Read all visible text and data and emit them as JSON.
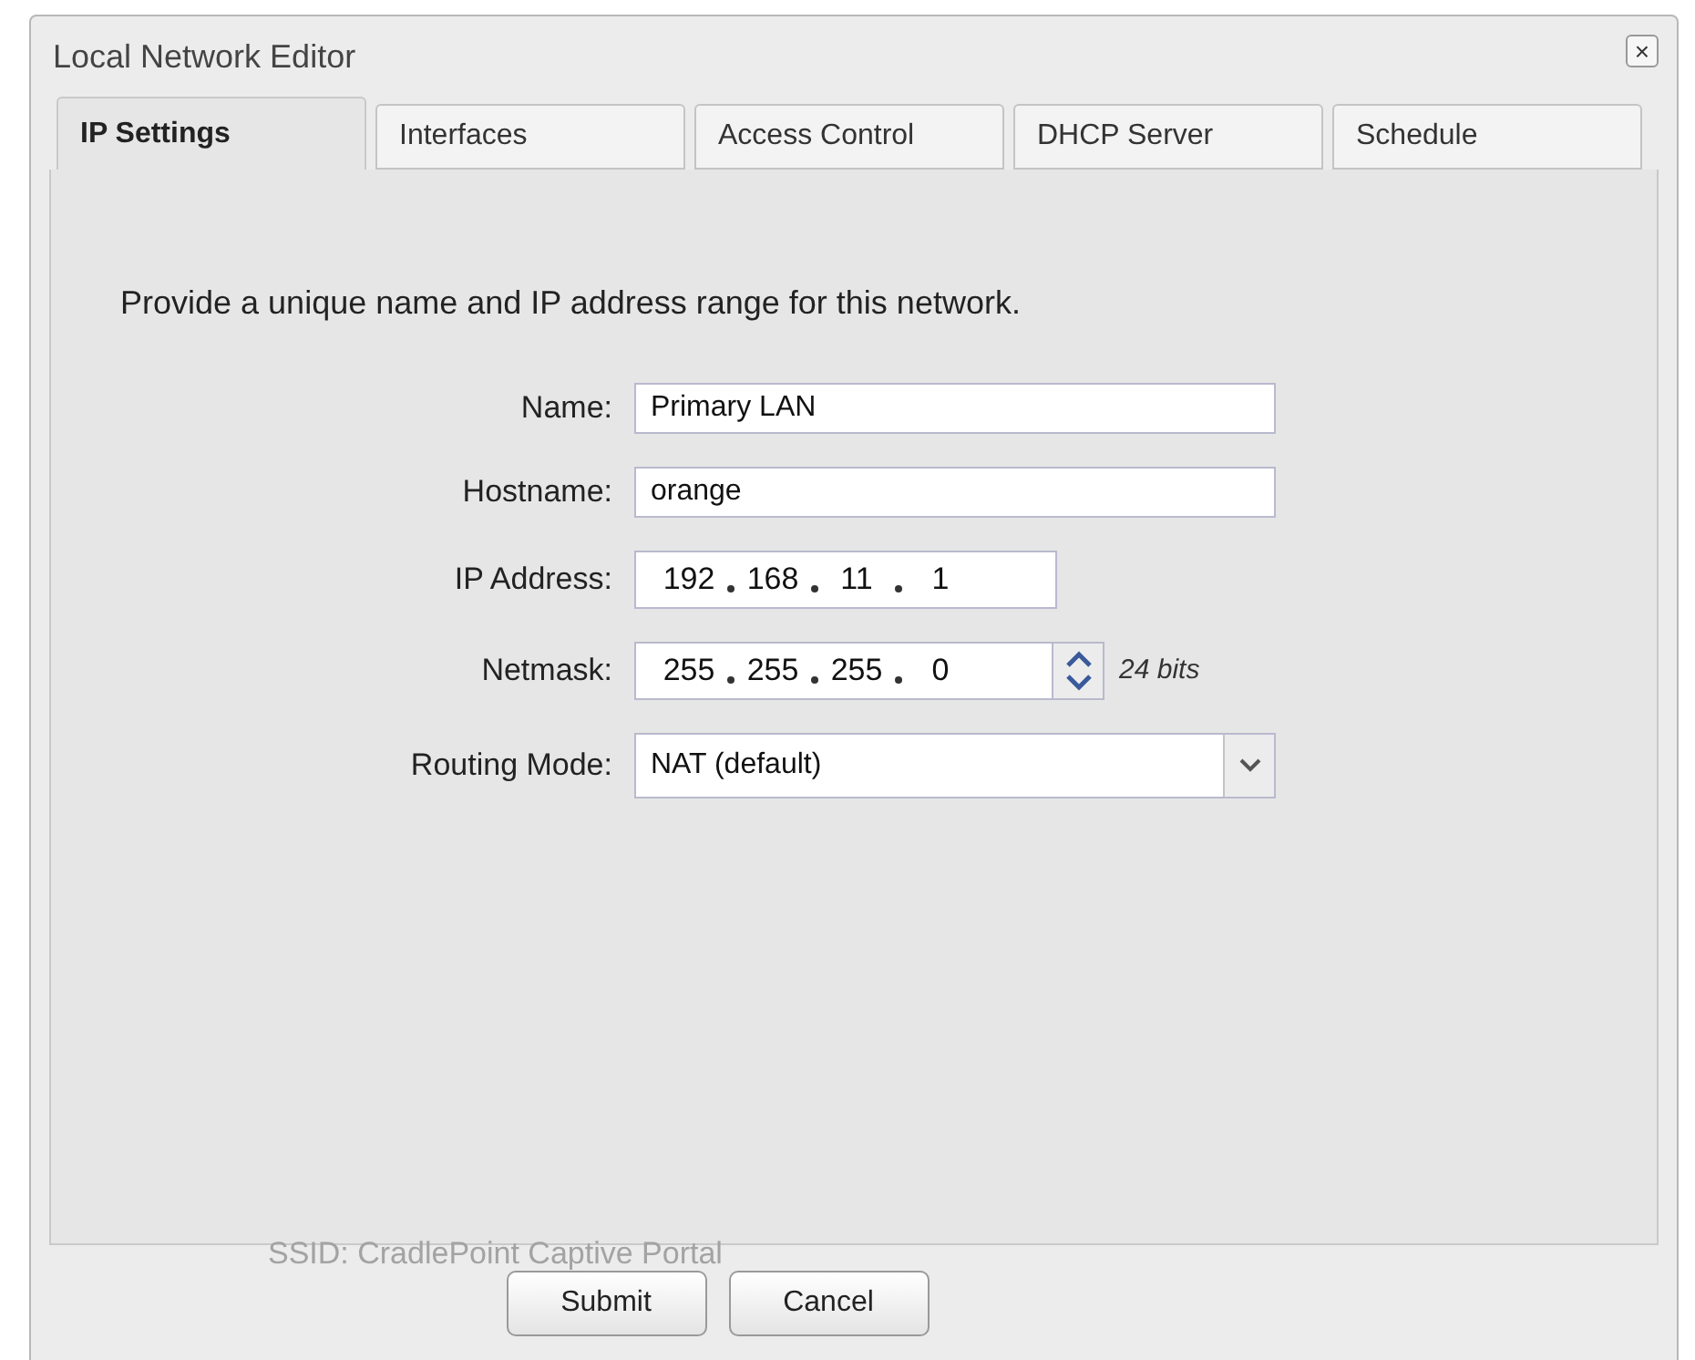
{
  "window": {
    "title": "Local Network Editor",
    "close": "×"
  },
  "tabs": [
    {
      "label": "IP Settings",
      "selected": true
    },
    {
      "label": "Interfaces",
      "selected": false
    },
    {
      "label": "Access Control",
      "selected": false
    },
    {
      "label": "DHCP Server",
      "selected": false
    },
    {
      "label": "Schedule",
      "selected": false
    }
  ],
  "intro": "Provide a unique name and IP address range for this network.",
  "fields": [
    {
      "kind": "text",
      "label": "Name:",
      "value": "Primary LAN"
    },
    {
      "kind": "text",
      "label": "Hostname:",
      "value": "orange"
    },
    {
      "kind": "ip",
      "label": "IP Address:",
      "octets": [
        "192",
        "168",
        "11",
        "1"
      ]
    },
    {
      "kind": "netmask",
      "label": "Netmask:",
      "octets": [
        "255",
        "255",
        "255",
        "0"
      ],
      "note": "24 bits"
    },
    {
      "kind": "select",
      "label": "Routing Mode:",
      "value": "NAT (default)"
    }
  ],
  "background_text": "SSID: CradlePoint Captive Portal",
  "buttons": [
    "Submit",
    "Cancel"
  ]
}
